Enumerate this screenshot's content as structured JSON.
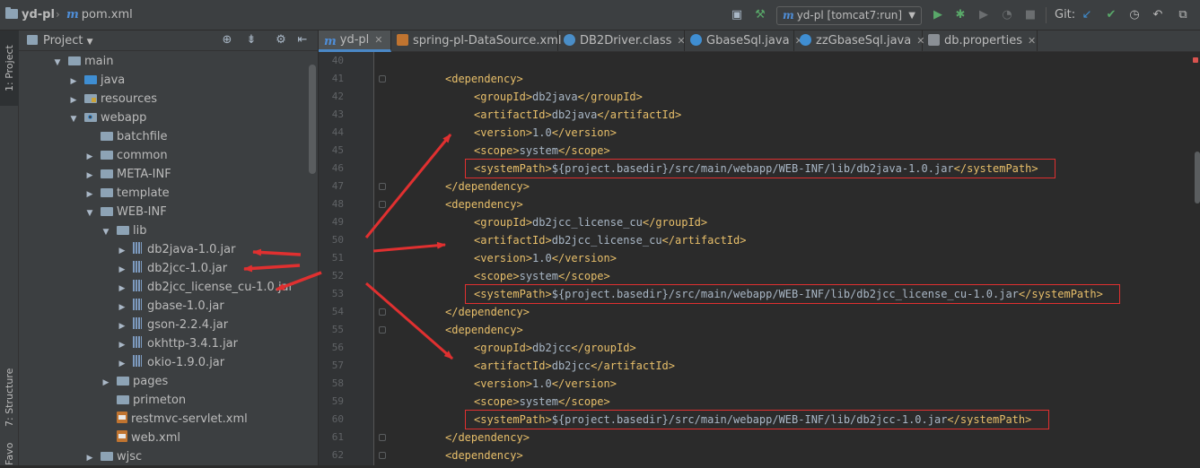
{
  "breadcrumb": {
    "project": "yd-pl",
    "file": "pom.xml"
  },
  "toolbar": {
    "run_config": "yd-pl [tomcat7:run]",
    "git_label": "Git:"
  },
  "left_strip": {
    "project_tab": "1: Project",
    "structure_tab": "7: Structure",
    "favorites_tab": "Favorites"
  },
  "project_panel": {
    "title": "Project",
    "tree": [
      {
        "label": "main",
        "depth": 0,
        "expanded": true,
        "icon": "folder-icon"
      },
      {
        "label": "java",
        "depth": 1,
        "expanded": false,
        "icon": "source-folder-icon"
      },
      {
        "label": "resources",
        "depth": 1,
        "expanded": false,
        "icon": "resources-folder-icon"
      },
      {
        "label": "webapp",
        "depth": 1,
        "expanded": true,
        "icon": "web-folder-icon"
      },
      {
        "label": "batchfile",
        "depth": 2,
        "icon": "folder-icon"
      },
      {
        "label": "common",
        "depth": 2,
        "expanded": false,
        "icon": "folder-icon"
      },
      {
        "label": "META-INF",
        "depth": 2,
        "expanded": false,
        "icon": "folder-icon"
      },
      {
        "label": "template",
        "depth": 2,
        "expanded": false,
        "icon": "folder-icon"
      },
      {
        "label": "WEB-INF",
        "depth": 2,
        "expanded": true,
        "icon": "folder-icon"
      },
      {
        "label": "lib",
        "depth": 3,
        "expanded": true,
        "icon": "folder-icon"
      },
      {
        "label": "db2java-1.0.jar",
        "depth": 4,
        "expanded": false,
        "icon": "jar-icon"
      },
      {
        "label": "db2jcc-1.0.jar",
        "depth": 4,
        "expanded": false,
        "icon": "jar-icon"
      },
      {
        "label": "db2jcc_license_cu-1.0.jar",
        "depth": 4,
        "expanded": false,
        "icon": "jar-icon"
      },
      {
        "label": "gbase-1.0.jar",
        "depth": 4,
        "expanded": false,
        "icon": "jar-icon"
      },
      {
        "label": "gson-2.2.4.jar",
        "depth": 4,
        "expanded": false,
        "icon": "jar-icon"
      },
      {
        "label": "okhttp-3.4.1.jar",
        "depth": 4,
        "expanded": false,
        "icon": "jar-icon"
      },
      {
        "label": "okio-1.9.0.jar",
        "depth": 4,
        "expanded": false,
        "icon": "jar-icon"
      },
      {
        "label": "pages",
        "depth": 3,
        "expanded": false,
        "icon": "folder-icon"
      },
      {
        "label": "primeton",
        "depth": 3,
        "icon": "folder-icon"
      },
      {
        "label": "restmvc-servlet.xml",
        "depth": 3,
        "icon": "xml-file-icon"
      },
      {
        "label": "web.xml",
        "depth": 3,
        "icon": "xml-file-icon"
      },
      {
        "label": "wjsc",
        "depth": 2,
        "expanded": false,
        "icon": "folder-icon"
      }
    ]
  },
  "editor": {
    "tabs": [
      {
        "label": "yd-pl",
        "icon": "maven-icon",
        "active": true
      },
      {
        "label": "spring-pl-DataSource.xml",
        "icon": "xml-file-icon",
        "active": false
      },
      {
        "label": "DB2Driver.class",
        "icon": "class-file-icon",
        "active": false
      },
      {
        "label": "GbaseSql.java",
        "icon": "java-class-icon",
        "active": false
      },
      {
        "label": "zzGbaseSql.java",
        "icon": "java-class-icon",
        "active": false
      },
      {
        "label": "db.properties",
        "icon": "properties-file-icon",
        "active": false
      }
    ],
    "lines": [
      {
        "num": "40",
        "indent": 0,
        "text": ""
      },
      {
        "num": "41",
        "indent": 1,
        "open": "dependency",
        "value": "",
        "close": ""
      },
      {
        "num": "42",
        "indent": 2,
        "open": "groupId",
        "value": "db2java",
        "close": "groupId"
      },
      {
        "num": "43",
        "indent": 2,
        "open": "artifactId",
        "value": "db2java",
        "close": "artifactId"
      },
      {
        "num": "44",
        "indent": 2,
        "open": "version",
        "value": "1.0",
        "close": "version"
      },
      {
        "num": "45",
        "indent": 2,
        "open": "scope",
        "value": "system",
        "close": "scope"
      },
      {
        "num": "46",
        "indent": 2,
        "open": "systemPath",
        "value": "${project.basedir}/src/main/webapp/WEB-INF/lib/db2java-1.0.jar",
        "close": "systemPath",
        "highlight": true
      },
      {
        "num": "47",
        "indent": 1,
        "open": "",
        "value": "",
        "close": "dependency"
      },
      {
        "num": "48",
        "indent": 1,
        "open": "dependency",
        "value": "",
        "close": ""
      },
      {
        "num": "49",
        "indent": 2,
        "open": "groupId",
        "value": "db2jcc_license_cu",
        "close": "groupId"
      },
      {
        "num": "50",
        "indent": 2,
        "open": "artifactId",
        "value": "db2jcc_license_cu",
        "close": "artifactId"
      },
      {
        "num": "51",
        "indent": 2,
        "open": "version",
        "value": "1.0",
        "close": "version"
      },
      {
        "num": "52",
        "indent": 2,
        "open": "scope",
        "value": "system",
        "close": "scope"
      },
      {
        "num": "53",
        "indent": 2,
        "open": "systemPath",
        "value": "${project.basedir}/src/main/webapp/WEB-INF/lib/db2jcc_license_cu-1.0.jar",
        "close": "systemPath",
        "highlight": true
      },
      {
        "num": "54",
        "indent": 1,
        "open": "",
        "value": "",
        "close": "dependency"
      },
      {
        "num": "55",
        "indent": 1,
        "open": "dependency",
        "value": "",
        "close": ""
      },
      {
        "num": "56",
        "indent": 2,
        "open": "groupId",
        "value": "db2jcc",
        "close": "groupId"
      },
      {
        "num": "57",
        "indent": 2,
        "open": "artifactId",
        "value": "db2jcc",
        "close": "artifactId"
      },
      {
        "num": "58",
        "indent": 2,
        "open": "version",
        "value": "1.0",
        "close": "version"
      },
      {
        "num": "59",
        "indent": 2,
        "open": "scope",
        "value": "system",
        "close": "scope"
      },
      {
        "num": "60",
        "indent": 2,
        "open": "systemPath",
        "value": "${project.basedir}/src/main/webapp/WEB-INF/lib/db2jcc-1.0.jar",
        "close": "systemPath",
        "highlight": true
      },
      {
        "num": "61",
        "indent": 1,
        "open": "",
        "value": "",
        "close": "dependency"
      },
      {
        "num": "62",
        "indent": 1,
        "open": "dependency",
        "value": "",
        "close": ""
      }
    ]
  },
  "colors": {
    "background": "#2b2b2b",
    "panel": "#3c3f41",
    "xml_tag": "#e8bf6a",
    "xml_text": "#a9b7c6",
    "annotation_red": "#e03030",
    "run_green": "#59a869"
  }
}
